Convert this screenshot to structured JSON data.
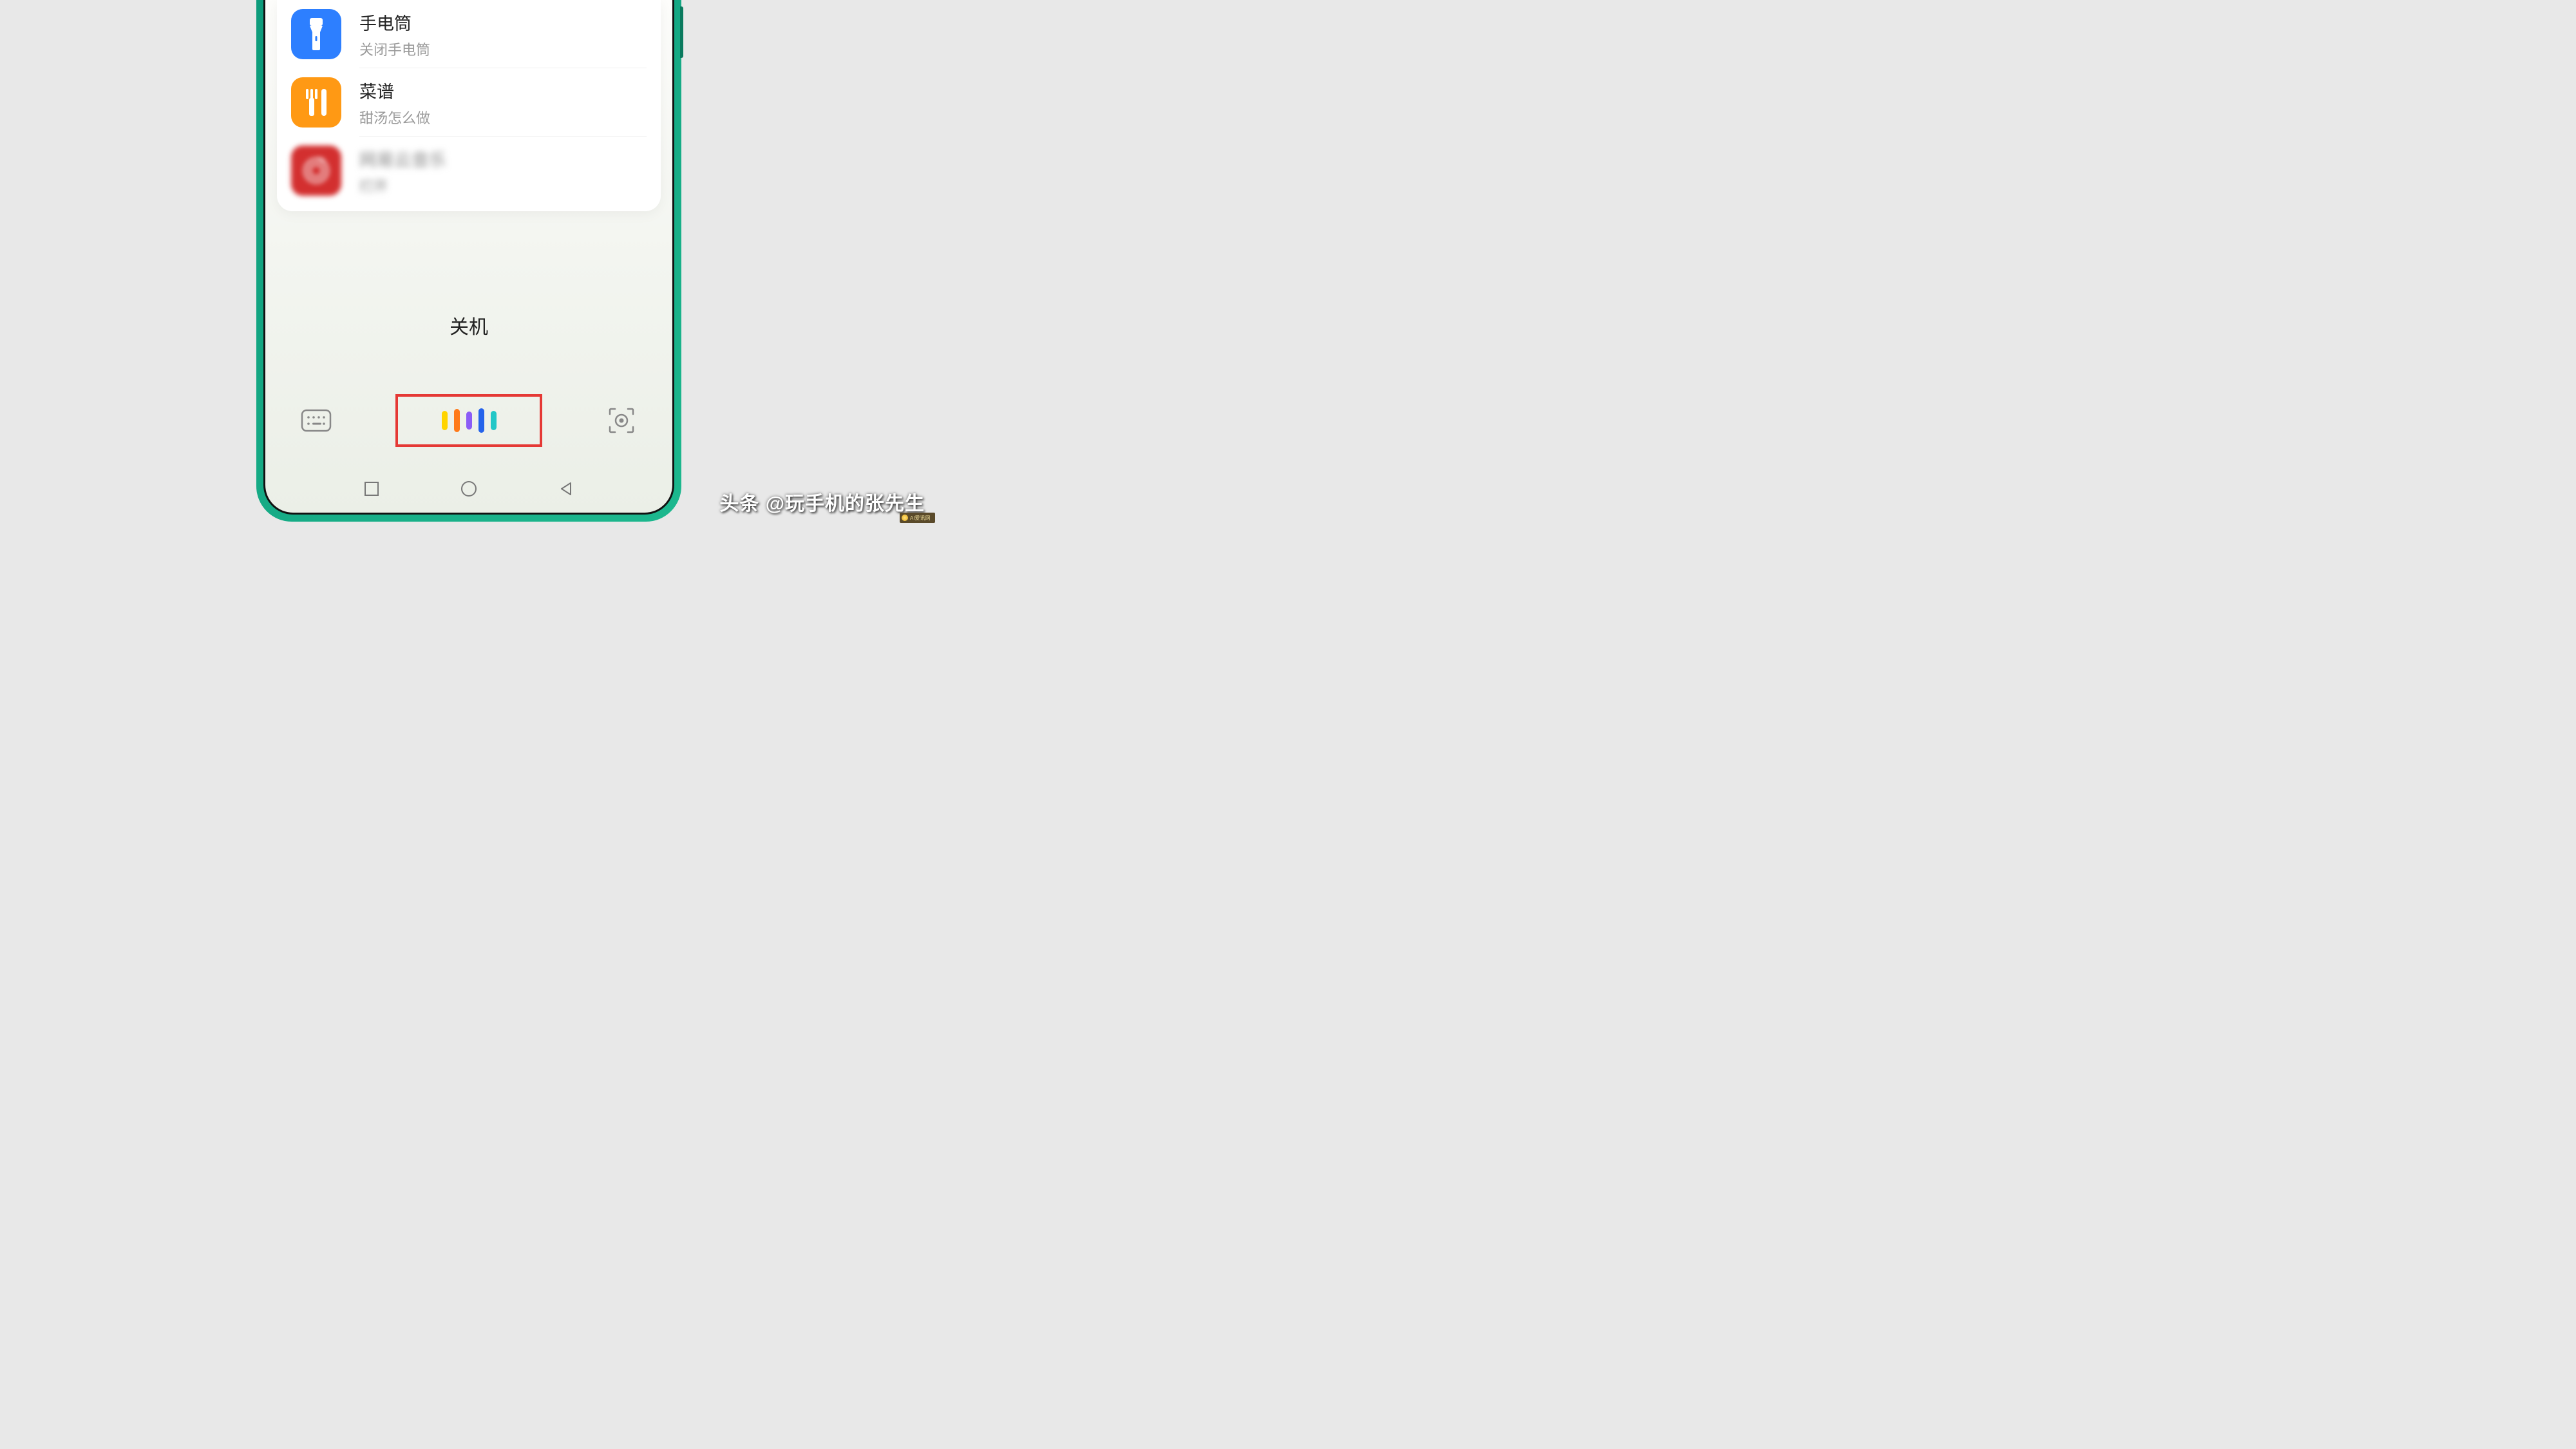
{
  "suggestions": [
    {
      "icon": "flashlight-icon",
      "title": "手电筒",
      "subtitle": "关闭手电筒"
    },
    {
      "icon": "recipe-icon",
      "title": "菜谱",
      "subtitle": "甜汤怎么做"
    },
    {
      "icon": "music-icon",
      "title": "网易云音乐",
      "subtitle": "打开"
    }
  ],
  "voice_command": "关机",
  "voice_colors": [
    "#ffd400",
    "#ff7a1a",
    "#8b5cf6",
    "#2563eb",
    "#22c7c7"
  ],
  "watermark": "头条 @玩手机的张先生",
  "badge_text": "AI爱讯网"
}
